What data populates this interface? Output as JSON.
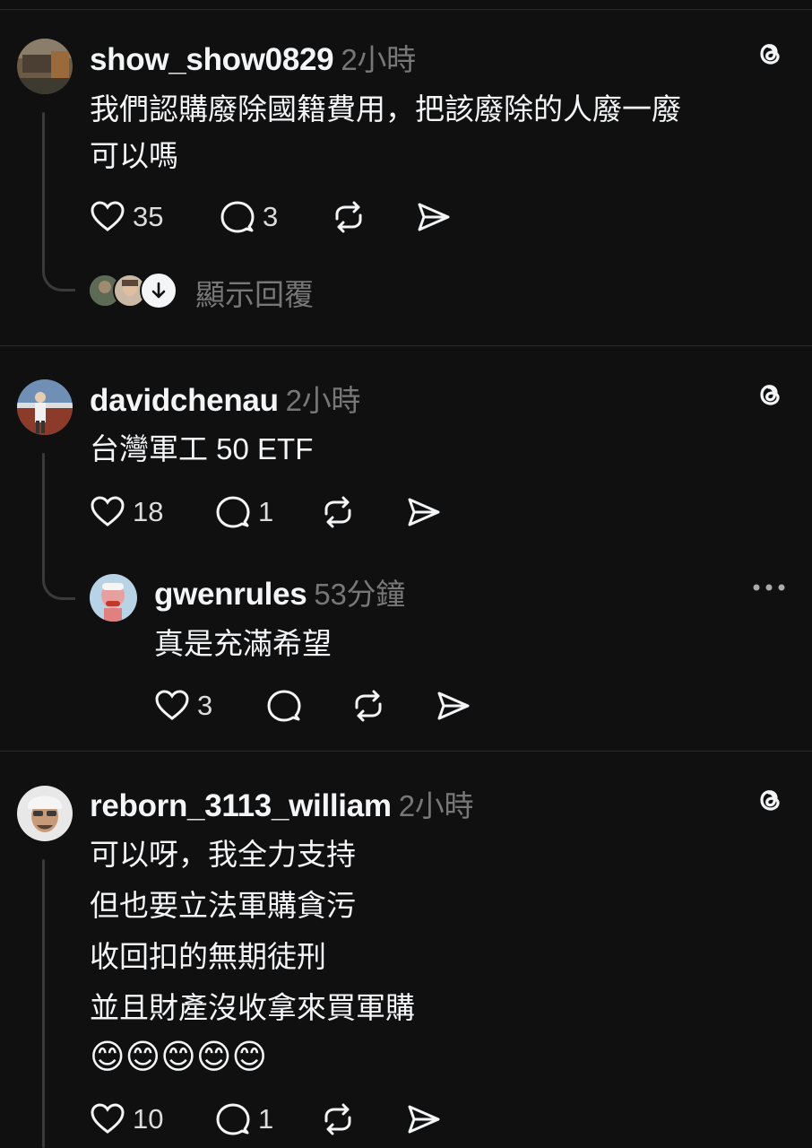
{
  "posts": [
    {
      "username": "show_show0829",
      "time": "2小時",
      "lines": [
        "我們認購廢除國籍費用，把該廢除的人廢一廢",
        "可以嗎"
      ],
      "likes": "35",
      "comments": "3",
      "show_replies_label": "顯示回覆"
    },
    {
      "username": "davidchenau",
      "time": "2小時",
      "lines": [
        "台灣軍工 50 ETF"
      ],
      "likes": "18",
      "comments": "1",
      "reply": {
        "username": "gwenrules",
        "time": "53分鐘",
        "lines": [
          "真是充滿希望"
        ],
        "likes": "3"
      }
    },
    {
      "username": "reborn_3113_william",
      "time": "2小時",
      "lines": [
        "可以呀，我全力支持",
        "但也要立法軍購貪污",
        "收回扣的無期徒刑",
        "並且財產沒收拿來買軍購"
      ],
      "emojis": "😊😊😊😊😊",
      "likes": "10",
      "comments": "1"
    }
  ],
  "colors": {
    "background": "#101010",
    "text": "#f3f5f7",
    "muted": "#777777",
    "divider": "#2a2a2a"
  }
}
